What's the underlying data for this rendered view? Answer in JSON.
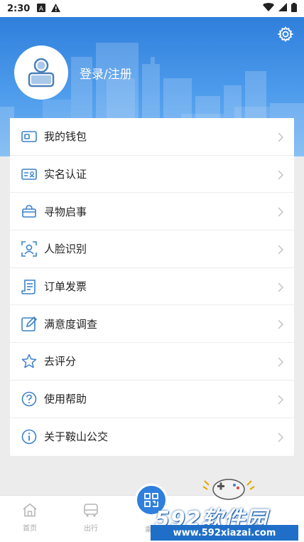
{
  "status_bar": {
    "time": "2:30"
  },
  "header": {
    "login_label": "登录/注册"
  },
  "menu": {
    "items": [
      {
        "label": "我的钱包",
        "icon": "wallet-icon"
      },
      {
        "label": "实名认证",
        "icon": "id-card-icon"
      },
      {
        "label": "寻物启事",
        "icon": "lost-bag-icon"
      },
      {
        "label": "人脸识别",
        "icon": "face-scan-icon"
      },
      {
        "label": "订单发票",
        "icon": "invoice-icon"
      },
      {
        "label": "满意度调查",
        "icon": "survey-pencil-icon"
      },
      {
        "label": "去评分",
        "icon": "star-icon"
      },
      {
        "label": "使用帮助",
        "icon": "help-icon"
      },
      {
        "label": "关于鞍山公交",
        "icon": "info-icon"
      }
    ]
  },
  "bottom_nav": {
    "home_label": "首页",
    "travel_label": "出行",
    "scan_label": "乘"
  },
  "watermark": {
    "brand": "592软件园",
    "url": "www.592xiazai.com"
  },
  "colors": {
    "accent": "#2f7fdc",
    "icon_blue": "#3b82c9"
  }
}
